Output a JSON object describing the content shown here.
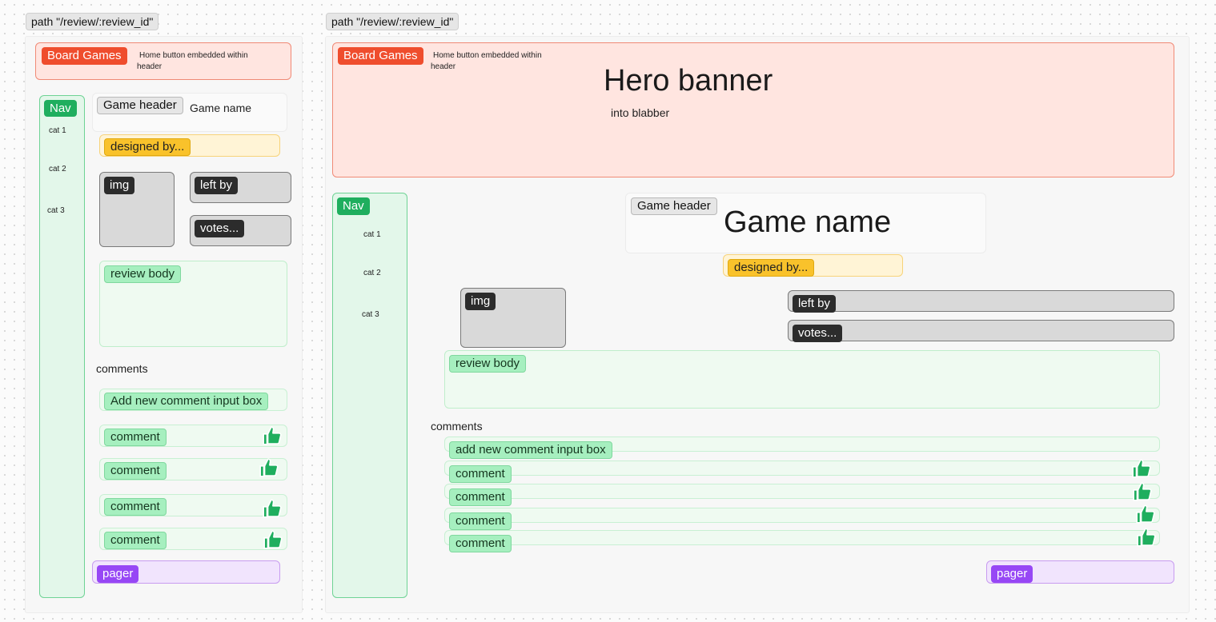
{
  "left": {
    "path_label": "path \"/review/:review_id\"",
    "header": {
      "home_chip": "Board Games",
      "note": "Home button embedded within header"
    },
    "nav": {
      "chip": "Nav",
      "items": [
        "cat 1",
        "cat 2",
        "cat 3"
      ]
    },
    "game_header": {
      "chip": "Game header",
      "game_name": "Game name"
    },
    "designed_by": "designed by...",
    "img": "img",
    "left_by": "left by",
    "votes": "votes...",
    "review_body": "review body",
    "comments_label": "comments",
    "add_comment": "Add new comment input box",
    "comments": [
      "comment",
      "comment",
      "comment",
      "comment"
    ],
    "pager": "pager"
  },
  "right": {
    "path_label": "path \"/review/:review_id\"",
    "header": {
      "home_chip": "Board Games",
      "note": "Home button embedded within header",
      "hero_title": "Hero banner",
      "hero_sub": "into blabber"
    },
    "nav": {
      "chip": "Nav",
      "items": [
        "cat 1",
        "cat 2",
        "cat 3"
      ]
    },
    "game_header": {
      "chip": "Game header",
      "game_name": "Game name"
    },
    "designed_by": "designed by...",
    "img": "img",
    "left_by": "left by",
    "votes": "votes...",
    "review_body": "review body",
    "comments_label": "comments",
    "add_comment": "add new comment input box",
    "comments": [
      "comment",
      "comment",
      "comment",
      "comment"
    ],
    "pager": "pager"
  },
  "icons": {
    "thumbs_up": "thumbs-up-icon"
  },
  "colors": {
    "header_fill": "#ffe5e0",
    "header_chip": "#ef4d2d",
    "nav_chip": "#1fae5e",
    "designed_chip": "#f9c22b",
    "pager_chip": "#9747f5",
    "thumbs_up": "#1fae5e"
  }
}
